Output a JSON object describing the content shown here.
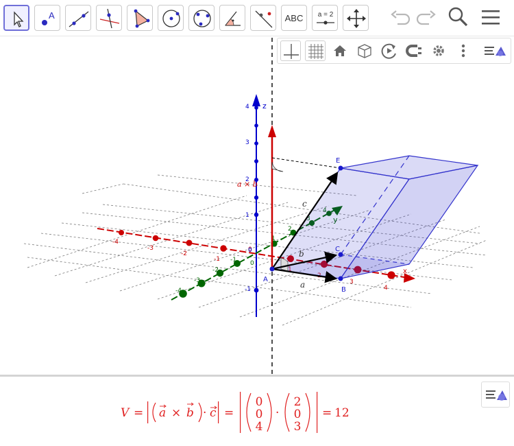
{
  "toolbar": {
    "tools": [
      {
        "name": "move-tool"
      },
      {
        "name": "point-tool",
        "label": "A"
      },
      {
        "name": "line-tool"
      },
      {
        "name": "perpendicular-line-tool"
      },
      {
        "name": "polygon-tool"
      },
      {
        "name": "circle-tool"
      },
      {
        "name": "conic-tool"
      },
      {
        "name": "angle-tool"
      },
      {
        "name": "reflect-tool"
      },
      {
        "name": "text-tool",
        "label": "ABC"
      },
      {
        "name": "slider-tool",
        "label": "a = 2"
      },
      {
        "name": "move-view-tool"
      }
    ],
    "right": [
      "undo-icon",
      "redo-icon",
      "search-icon",
      "menu-icon"
    ]
  },
  "stylebar": {
    "buttons": [
      "axes-icon",
      "grid-icon",
      "home-icon",
      "view-cube-icon",
      "rotate-icon",
      "projection-icon",
      "settings-icon",
      "more-icon",
      "toggle-stylebar-icon"
    ]
  },
  "graphics": {
    "axis_labels": {
      "x": "x",
      "y": "y",
      "z": "z"
    },
    "x_ticks": [
      "-4",
      "-3",
      "-2",
      "-1",
      "0",
      "1",
      "2",
      "3",
      "4"
    ],
    "y_ticks": [
      "-4",
      "-3",
      "-2",
      "-1",
      "0",
      "1",
      "2",
      "3",
      "4"
    ],
    "z_ticks": [
      "-1",
      "0",
      "1",
      "2",
      "3",
      "4"
    ],
    "points": {
      "A": "A",
      "B": "B",
      "C": "C",
      "E": "E"
    },
    "vector_labels": {
      "a": "a",
      "b": "b",
      "c": "c",
      "cross": "a × b"
    },
    "colors": {
      "x_axis": "#cc0000",
      "y_axis": "#006600",
      "z_axis": "#0000cc",
      "prism": "#3333cc",
      "cross": "#cc0000",
      "vectors": "#000000"
    }
  },
  "algebra": {
    "formula": {
      "lhs": "V",
      "eq1": "=",
      "a": "a",
      "times": "×",
      "b": "b",
      "dot1": "·",
      "c": "c",
      "eq2": "=",
      "vec1": [
        "0",
        "0",
        "4"
      ],
      "dot2": "·",
      "vec2": [
        "2",
        "0",
        "3"
      ],
      "eq3": "=",
      "result": "12"
    },
    "color": "#e02020"
  }
}
